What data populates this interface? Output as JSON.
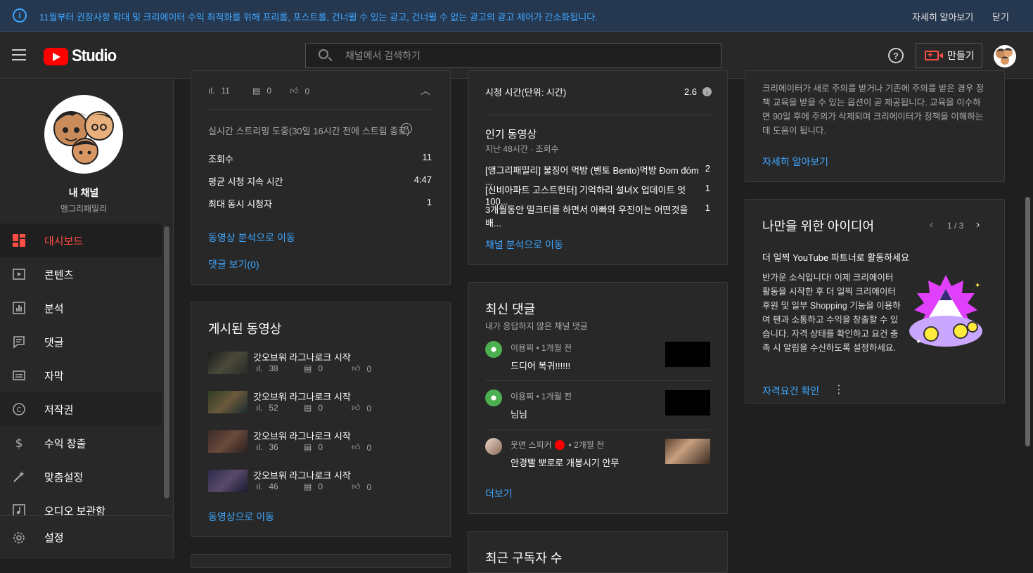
{
  "banner": {
    "message": "11월부터 권장사항 확대 및 크리에이터 수익 최적화를 위해 프리롤, 포스트롤, 건너뛸 수 있는 광고, 건너뛸 수 없는 광고의 광고 제어가 간소화됩니다.",
    "learn_more": "자세히 알아보기",
    "close": "닫기"
  },
  "header": {
    "logo_text": "Studio",
    "search_placeholder": "채널에서 검색하기",
    "create_label": "만들기"
  },
  "sidebar": {
    "channel_title": "내 채널",
    "channel_name": "앵그리패밀리",
    "items": [
      {
        "label": "대시보드",
        "icon": "dashboard-icon",
        "glyph": "▦"
      },
      {
        "label": "콘텐츠",
        "icon": "content-icon",
        "glyph": "▶"
      },
      {
        "label": "분석",
        "icon": "analytics-icon",
        "glyph": "▥"
      },
      {
        "label": "댓글",
        "icon": "comments-icon",
        "glyph": "▤"
      },
      {
        "label": "자막",
        "icon": "subtitles-icon",
        "glyph": "▭"
      },
      {
        "label": "저작권",
        "icon": "copyright-icon",
        "glyph": "©"
      },
      {
        "label": "수익 창출",
        "icon": "monetization-icon",
        "glyph": "$"
      },
      {
        "label": "맞춤설정",
        "icon": "customization-icon",
        "glyph": "✎"
      },
      {
        "label": "오디오 보관함",
        "icon": "audio-library-icon",
        "glyph": "♫"
      }
    ],
    "settings_label": "설정"
  },
  "latest_video": {
    "views": "11",
    "comments": "0",
    "likes": "0",
    "stream_note": "실시간 스트리밍 도중(30일 16시간 전에 스트림 종료)",
    "metrics": [
      {
        "label": "조회수",
        "value": "11"
      },
      {
        "label": "평균 시청 지속 시간",
        "value": "4:47"
      },
      {
        "label": "최대 동시 시청자",
        "value": "1"
      }
    ],
    "analytics_link": "동영상 분석으로 이동",
    "comments_link": "댓글 보기(0)"
  },
  "published": {
    "title": "게시된 동영상",
    "videos": [
      {
        "title": "갓오브워 라그나로크 시작",
        "views": "38",
        "comments": "0",
        "likes": "0"
      },
      {
        "title": "갓오브워 라그나로크 시작",
        "views": "52",
        "comments": "0",
        "likes": "0"
      },
      {
        "title": "갓오브워 라그나로크 시작",
        "views": "36",
        "comments": "0",
        "likes": "0"
      },
      {
        "title": "갓오브워 라그나로크 시작",
        "views": "46",
        "comments": "0",
        "likes": "0"
      }
    ],
    "link": "동영상으로 이동"
  },
  "analytics": {
    "watch_time_label": "시청 시간(단위: 시간)",
    "watch_time_value": "2.6",
    "top_title": "인기 동영상",
    "top_subtitle": "지난 48시간 · 조회수",
    "top_videos": [
      {
        "title": "[앵그리패밀리] 불징어 먹방 (벤토 Bento)먹방 Đom đóm ...",
        "value": "2"
      },
      {
        "title": "[신비아파트 고스트헌터] 기억하리 설녀X 업데이트 엇100...",
        "value": "1"
      },
      {
        "title": "3개월동안 밀크티를 하면서 아빠와 우진이는 어떤것을 배...",
        "value": "1"
      }
    ],
    "link": "채널 분석으로 이동"
  },
  "recent_comments": {
    "title": "최신 댓글",
    "subtitle": "내가 응답하지 않은 채널 댓글",
    "items": [
      {
        "author": "이용찌",
        "time": "• 1개월 전",
        "text": "드디어 복귀!!!!!!"
      },
      {
        "author": "이용찌",
        "time": "• 1개월 전",
        "text": "님님"
      },
      {
        "author": "웃면 스피커",
        "time": "• 2개월 전",
        "text": "안경빨 뽀로로 개봉시기 안무"
      }
    ],
    "more": "더보기"
  },
  "subscribers": {
    "title": "최근 구독자 수"
  },
  "policy": {
    "text": "크리에이터가 새로 주의를 받거나 기존에 주의를 받은 경우 정책 교육을 받을 수 있는 옵션이 곧 제공됩니다. 교육을 이수하면 90일 후에 주의가 삭제되며 크리에이터가 정책을 이해하는 데 도움이 됩니다.",
    "link": "자세히 알아보기"
  },
  "ideas": {
    "title": "나만을 위한 아이디어",
    "pager": "1 / 3",
    "headline": "더 일찍 YouTube 파트너로 활동하세요",
    "body": "반가운 소식입니다! 이제 크리에이터 활동을 시작한 후 더 일찍 크리에이터 후원 및 일부 Shopping 기능을 이용하여 팬과 소통하고 수익을 창출할 수 있습니다. 자격 상태를 확인하고 요건 충족 시 알림을 수신하도록 설정하세요.",
    "cta": "자격요건 확인"
  },
  "colors": {
    "accent_red": "#ff4e45",
    "link_blue": "#3ea6ff",
    "background": "#1f1f1f",
    "surface": "#282828"
  }
}
